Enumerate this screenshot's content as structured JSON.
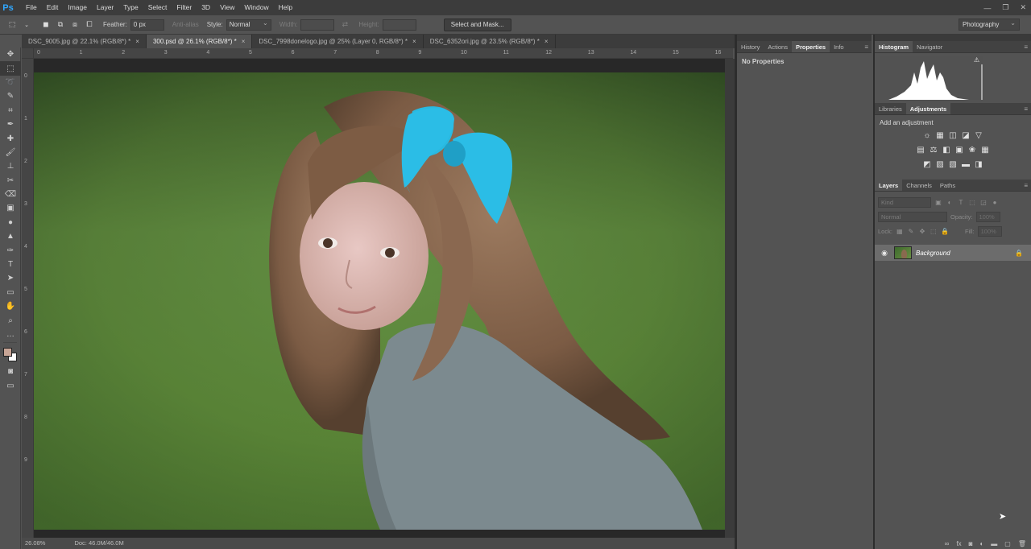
{
  "app": {
    "logo": "Ps",
    "menu": [
      "File",
      "Edit",
      "Image",
      "Layer",
      "Type",
      "Select",
      "Filter",
      "3D",
      "View",
      "Window",
      "Help"
    ],
    "window_controls": [
      "—",
      "❐",
      "✕"
    ]
  },
  "options_bar": {
    "feather_label": "Feather:",
    "feather_value": "0 px",
    "antialias_label": "Anti-alias",
    "style_label": "Style:",
    "style_value": "Normal",
    "width_label": "Width:",
    "height_label": "Height:",
    "select_mask_label": "Select and Mask...",
    "workspace": "Photography"
  },
  "document_tabs": [
    {
      "title": "DSC_9005.jpg @ 22.1% (RGB/8*) *",
      "active": false
    },
    {
      "title": "300.psd @ 26.1% (RGB/8*) *",
      "active": true
    },
    {
      "title": "DSC_7998donelogo.jpg @ 25% (Layer 0, RGB/8*) *",
      "active": false
    },
    {
      "title": "DSC_6352ori.jpg @ 23.5% (RGB/8*) *",
      "active": false
    }
  ],
  "ruler": {
    "h_numbers": [
      "0",
      "1",
      "2",
      "3",
      "4",
      "5",
      "6",
      "7",
      "8",
      "9",
      "10",
      "11",
      "12",
      "13",
      "14",
      "15",
      "16"
    ],
    "v_numbers": [
      "0",
      "1",
      "2",
      "3",
      "4",
      "5",
      "6",
      "7",
      "8",
      "9"
    ]
  },
  "status": {
    "zoom": "26.08%",
    "doc": "Doc: 46.0M/46.0M"
  },
  "panels": {
    "left_tabs": [
      "History",
      "Actions",
      "Properties",
      "Info"
    ],
    "left_active": "Properties",
    "no_properties": "No Properties",
    "hist_tabs": [
      "Histogram",
      "Navigator"
    ],
    "hist_active": "Histogram",
    "lib_tabs": [
      "Libraries",
      "Adjustments"
    ],
    "lib_active": "Adjustments",
    "add_adjustment": "Add an adjustment",
    "layer_tabs": [
      "Layers",
      "Channels",
      "Paths"
    ],
    "layer_active": "Layers",
    "kind_placeholder": "Kind",
    "blend_mode": "Normal",
    "opacity_label": "Opacity:",
    "opacity_value": "100%",
    "lock_label": "Lock:",
    "fill_label": "Fill:",
    "fill_value": "100%",
    "layers": [
      {
        "name": "Background",
        "visible": true,
        "locked": true
      }
    ]
  },
  "colors": {
    "foreground": "#c8a596",
    "background": "#ffffff",
    "accent": "#31a8ff"
  }
}
